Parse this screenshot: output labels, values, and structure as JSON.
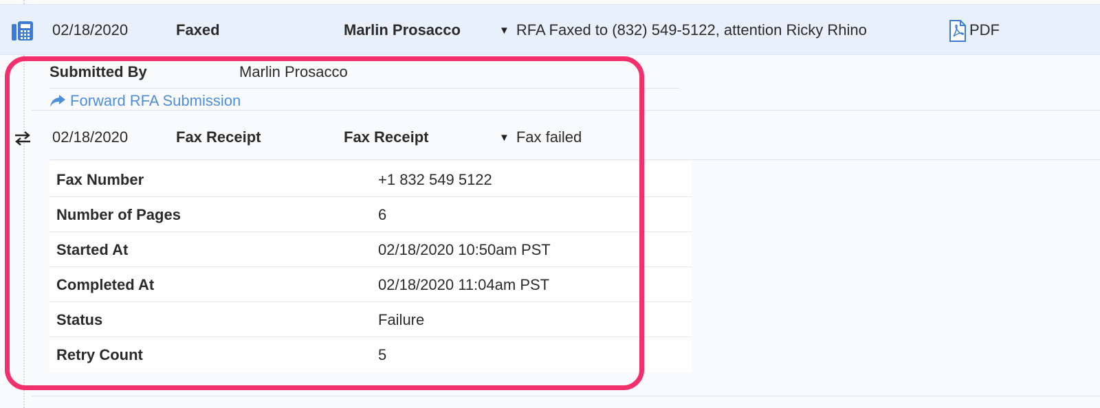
{
  "event": {
    "date": "02/18/2020",
    "type": "Faxed",
    "submitter": "Marlin Prosacco",
    "description": "RFA Faxed to (832) 549-5122, attention Ricky Rhino",
    "pdf_label": "PDF"
  },
  "submitted": {
    "label": "Submitted By",
    "value": "Marlin Prosacco"
  },
  "forward_link": "Forward RFA Submission",
  "receipt": {
    "date": "02/18/2020",
    "type": "Fax Receipt",
    "title": "Fax Receipt",
    "status": "Fax failed"
  },
  "details": [
    {
      "label": "Fax Number",
      "value": "+1 832 549 5122"
    },
    {
      "label": "Number of Pages",
      "value": "6"
    },
    {
      "label": "Started At",
      "value": "02/18/2020 10:50am PST"
    },
    {
      "label": "Completed At",
      "value": "02/18/2020 11:04am PST"
    },
    {
      "label": "Status",
      "value": "Failure"
    },
    {
      "label": "Retry Count",
      "value": "5"
    }
  ],
  "colors": {
    "highlight": "#f2306b",
    "link": "#4f8ed8",
    "row_bg": "#e8f0fb",
    "icon": "#3a7bd5"
  },
  "icons": [
    "fax-icon",
    "pdf-icon",
    "caret-down-icon",
    "share-arrow-icon",
    "swap-arrows-icon"
  ]
}
